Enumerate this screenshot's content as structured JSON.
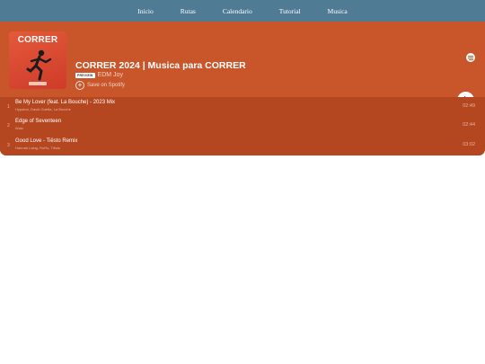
{
  "nav": [
    "Inicio",
    "Rutas",
    "Calendario",
    "Tutorial",
    "Musica"
  ],
  "player": {
    "cover_title": "CORRER",
    "title": "CORRER 2024 | Musica para CORRER",
    "preview_badge": "PREVIEW",
    "artist": "EDM Joy",
    "save_label": "Save on Spotify"
  },
  "tracks": [
    {
      "num": "1",
      "name": "Be My Lover (feat. La Bouche) - 2023 Mix",
      "artists": "Hypaton, David Guetta, La Bouche",
      "duration": "02:49"
    },
    {
      "num": "2",
      "name": "Edge of Seventeen",
      "artists": "Wuki",
      "duration": "02:44"
    },
    {
      "num": "3",
      "name": "Good Love - Tiësto Remix",
      "artists": "Hannah Laing, RoRo, Tiësto",
      "duration": "03:02"
    }
  ],
  "colors": {
    "nav_bg": "#4f7b95",
    "embed_bg": "#c55023",
    "tracks_bg": "#b44620"
  },
  "icons": [
    "spotify-icon",
    "previous-icon",
    "next-icon",
    "more-icon",
    "play-icon",
    "plus-circle-icon"
  ]
}
